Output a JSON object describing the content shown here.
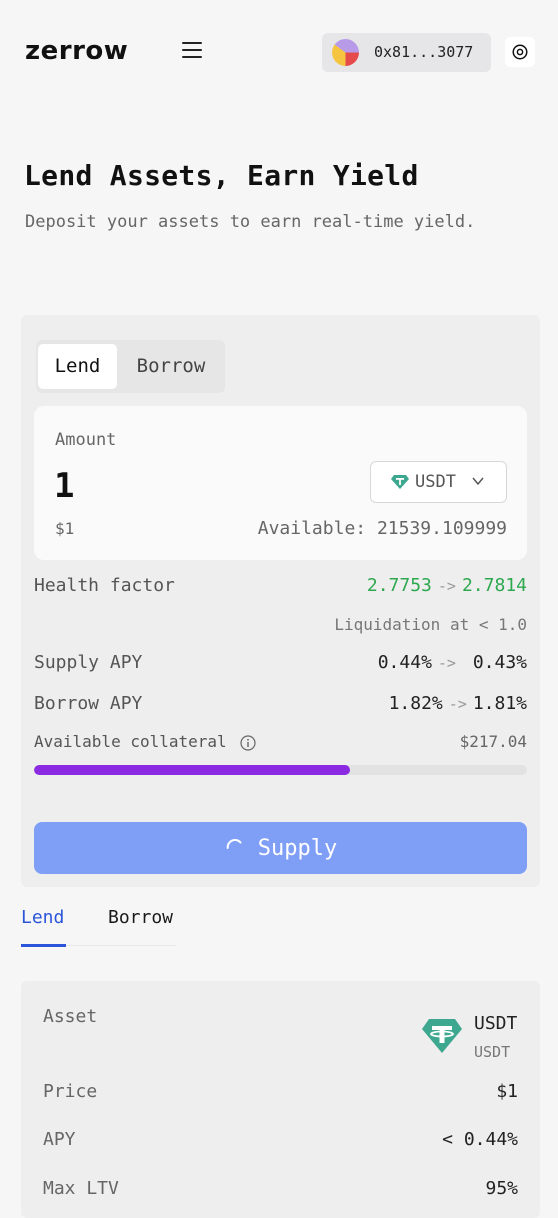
{
  "header": {
    "logo": "zerrow",
    "wallet_address": "0x81...3077"
  },
  "hero": {
    "title": "Lend Assets, Earn Yield",
    "subtitle": "Deposit your assets to earn real-time yield."
  },
  "form": {
    "tabs": [
      "Lend",
      "Borrow"
    ],
    "active_tab": "Lend",
    "amount_label": "Amount",
    "amount_value": "1",
    "token": "USDT",
    "usd_value": "$1",
    "available": "Available: 21539.109999",
    "health_factor": {
      "label": "Health factor",
      "from": "2.7753",
      "arrow": "->",
      "to": "2.7814"
    },
    "liquidation": "Liquidation at < 1.0",
    "supply_apy": {
      "label": "Supply APY",
      "from": "0.44%",
      "arrow": "->",
      "to": "0.43%"
    },
    "borrow_apy": {
      "label": "Borrow APY",
      "from": "1.82%",
      "arrow": "->",
      "to": "1.81%"
    },
    "available_collateral": {
      "label": "Available collateral",
      "value": "$217.04",
      "fill_percent": 64
    },
    "submit_label": "Supply"
  },
  "market_tabs": [
    "Lend",
    "Borrow"
  ],
  "market_active_tab": "Lend",
  "details": {
    "asset_label": "Asset",
    "asset_symbol": "USDT",
    "asset_sub": "USDT",
    "price_label": "Price",
    "price_value": "$1",
    "apy_label": "APY",
    "apy_value": "< 0.44%",
    "max_ltv_label": "Max LTV",
    "max_ltv_value": "95%"
  },
  "colors": {
    "accent_blue": "#2b55d9",
    "button": "#7f9ef5",
    "progress": "#8a2be2",
    "green": "#2ea84f",
    "tether": "#3da88f"
  }
}
